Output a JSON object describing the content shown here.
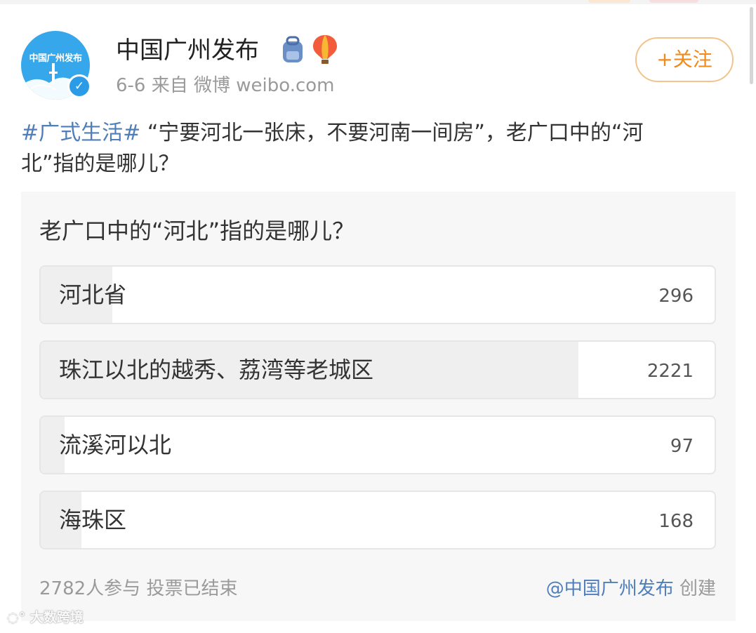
{
  "post": {
    "author": "中国广州发布",
    "avatar_text": "中国广州发布",
    "verified_mark": "✓",
    "date": "6-6",
    "source": "来自 微博 weibo.com",
    "follow_label": "+关注",
    "hashtag": "#广式生活#",
    "text": "“宁要河北一张床，不要河南一间房”，老广口中的“河北”指的是哪儿？",
    "emojis": [
      "backpack-icon",
      "hot-air-balloon-icon"
    ]
  },
  "poll": {
    "title": "老广口中的“河北”指的是哪儿？",
    "options": [
      {
        "label": "河北省",
        "count": "296",
        "share": 0.1064
      },
      {
        "label": "珠江以北的越秀、荔湾等老城区",
        "count": "2221",
        "share": 0.7983
      },
      {
        "label": "流溪河以北",
        "count": "97",
        "share": 0.0349
      },
      {
        "label": "海珠区",
        "count": "168",
        "share": 0.0604
      }
    ],
    "participants": "2782人参与",
    "status": "投票已结束",
    "creator_mention": "@中国广州发布",
    "creator_suffix": "创建"
  },
  "watermark": "大数跨境",
  "colors": {
    "hashtag": "#4f7eb8",
    "follow": "#f08a1a",
    "follow_border": "#f2c48c",
    "avatar_bg": "#35a7ea",
    "poll_bg": "#f7f7f7"
  }
}
